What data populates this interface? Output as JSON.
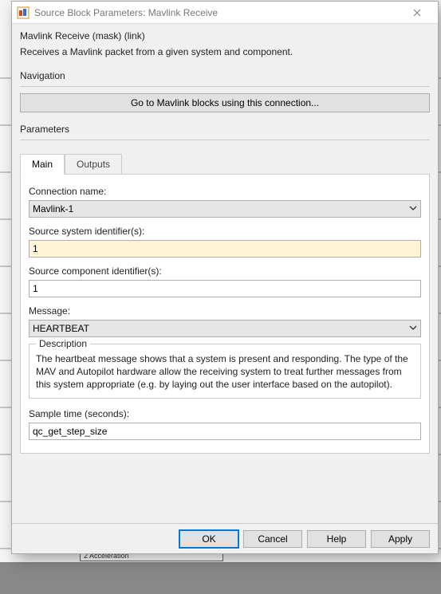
{
  "window": {
    "title": "Source Block Parameters: Mavlink Receive"
  },
  "header": {
    "mask_title": "Mavlink Receive (mask) (link)",
    "description": "Receives a Mavlink packet from a given system and component."
  },
  "navigation": {
    "section_label": "Navigation",
    "button_label": "Go to Mavlink blocks using this connection..."
  },
  "parameters": {
    "section_label": "Parameters",
    "tabs": [
      {
        "label": "Main",
        "active": true
      },
      {
        "label": "Outputs",
        "active": false
      }
    ],
    "main": {
      "connection_name": {
        "label": "Connection name:",
        "value": "Mavlink-1"
      },
      "source_system": {
        "label": "Source system identifier(s):",
        "value": "1"
      },
      "source_component": {
        "label": "Source component identifier(s):",
        "value": "1"
      },
      "message": {
        "label": "Message:",
        "value": "HEARTBEAT"
      },
      "description_group": {
        "legend": "Description",
        "body": "The heartbeat message shows that a system is present and responding. The type of the MAV and Autopilot hardware allow the receiving system to treat further messages from this system appropriate (e.g. by laying out the user interface based on the autopilot)."
      },
      "sample_time": {
        "label": "Sample time (seconds):",
        "value": "qc_get_step_size"
      }
    }
  },
  "buttons": {
    "ok": "OK",
    "cancel": "Cancel",
    "help": "Help",
    "apply": "Apply"
  },
  "background": {
    "hidden_block_label": "2 Acceleration"
  }
}
